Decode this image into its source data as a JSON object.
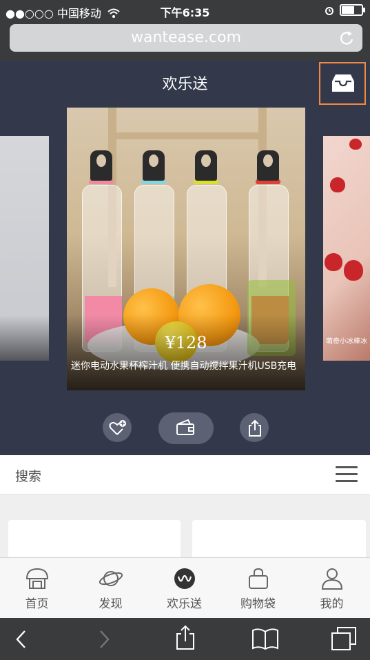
{
  "status_bar": {
    "signal": "●●○○○",
    "carrier": "中国移动",
    "wifi_icon": "wifi-icon",
    "time": "下午6:35",
    "alarm_icon": "alarm-icon",
    "battery_level": 0.6
  },
  "browser": {
    "url": "wantease.com",
    "reload_icon": "reload-icon"
  },
  "header": {
    "title": "欢乐送",
    "inbox_icon": "inbox-icon"
  },
  "carousel": {
    "current": {
      "price": "¥128",
      "title": "迷你电动水果杯榨汁机 便携自动搅拌果汁机USB充电"
    },
    "next": {
      "title": "萌奇小冰棒冰"
    }
  },
  "actions": {
    "like_icon": "heart-plus-icon",
    "wallet_icon": "wallet-icon",
    "share_icon": "share-icon"
  },
  "search": {
    "label": "搜索",
    "menu_icon": "menu-icon"
  },
  "tabs": [
    {
      "label": "首页",
      "icon": "home-icon"
    },
    {
      "label": "发现",
      "icon": "planet-icon"
    },
    {
      "label": "欢乐送",
      "icon": "logo-icon"
    },
    {
      "label": "购物袋",
      "icon": "bag-icon"
    },
    {
      "label": "我的",
      "icon": "user-icon"
    }
  ],
  "toolbar": {
    "back_icon": "back-icon",
    "forward_icon": "forward-icon",
    "share_icon": "share-icon",
    "bookmarks_icon": "book-icon",
    "tabs_icon": "tabs-icon"
  }
}
